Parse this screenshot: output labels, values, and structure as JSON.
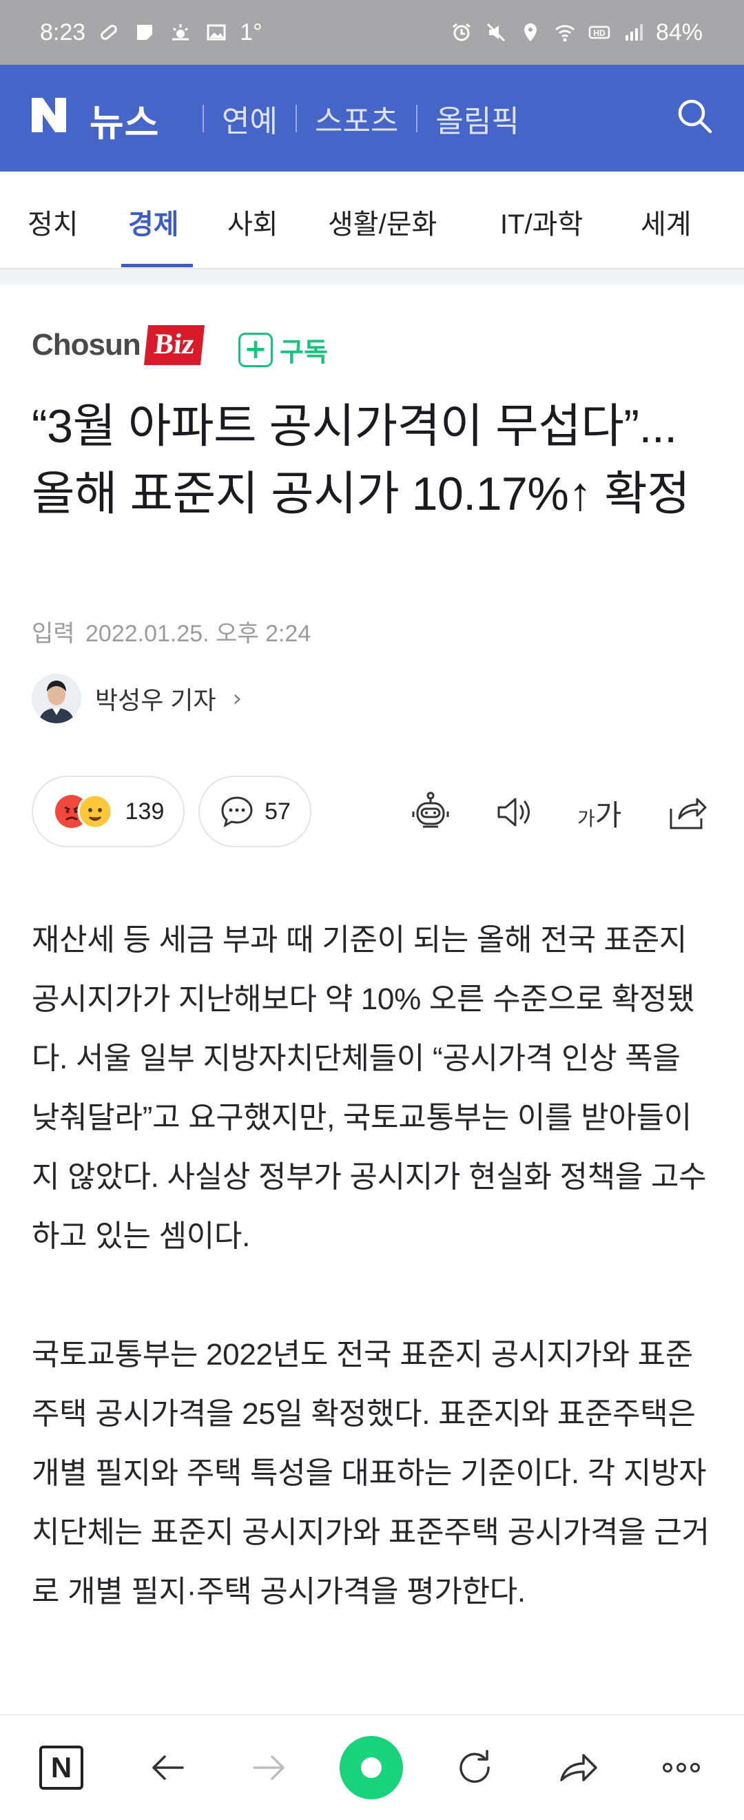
{
  "status_bar": {
    "time": "8:23",
    "temperature": "1°",
    "battery": "84%"
  },
  "top_bar": {
    "brand": "뉴스",
    "nav": [
      "연예",
      "스포츠",
      "올림픽"
    ],
    "colors": {
      "background": "#4565c8"
    }
  },
  "category_tabs": {
    "items": [
      "정치",
      "경제",
      "사회",
      "생활/문화",
      "IT/과학",
      "세계"
    ],
    "active": "경제",
    "accent": "#3a5cc4"
  },
  "press": {
    "logo_text_1": "Chosun",
    "logo_text_2": "Biz",
    "subscribe_label": "구독",
    "subscribe_color": "#17c27e"
  },
  "article": {
    "headline": "“3월 아파트 공시가격이 무섭다”... 올해 표준지 공시가 10.17%↑ 확정",
    "date_label": "입력",
    "date": "2022.01.25. 오후 2:24",
    "reporter": "박성우 기자",
    "paragraphs": [
      "재산세 등 세금 부과 때 기준이 되는 올해 전국 표준지 공시지가가 지난해보다 약 10% 오른 수준으로 확정됐다. 서울 일부 지방자치단체들이 “공시가격 인상 폭을 낮춰달라”고 요구했지만, 국토교통부는 이를 받아들이지 않았다. 사실상 정부가 공시지가 현실화 정책을 고수하고 있는 셈이다.",
      "국토교통부는 2022년도 전국 표준지 공시지가와 표준주택 공시가격을 25일 확정했다. 표준지와 표준주택은 개별 필지와 주택 특성을 대표하는 기준이다. 각 지방자치단체는 표준지 공시지가와 표준주택 공시가격을 근거로 개별 필지·주택 공시가격을 평가한다."
    ]
  },
  "actions": {
    "reaction_count": "139",
    "comment_count": "57",
    "font_small": "가",
    "font_big": "가"
  },
  "bottom_bar": {
    "icons": [
      "naver-home-icon",
      "back-icon",
      "forward-icon",
      "green-dot-icon",
      "refresh-icon",
      "share-icon",
      "more-icon"
    ]
  }
}
